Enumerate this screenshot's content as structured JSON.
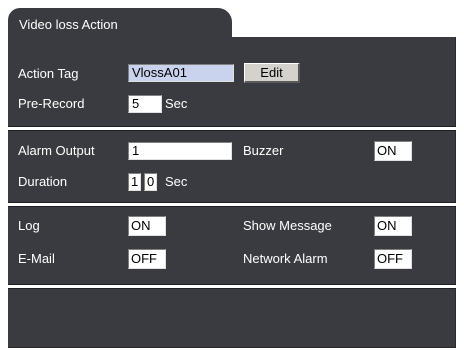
{
  "window": {
    "tab_title": "Video loss Action"
  },
  "action": {
    "tag_label": "Action Tag",
    "tag_value": "VlossA01",
    "edit_label": "Edit",
    "prerecord_label": "Pre-Record",
    "prerecord_value": "5",
    "prerecord_unit": "Sec"
  },
  "alarm": {
    "output_label": "Alarm Output",
    "output_value": "1",
    "buzzer_label": "Buzzer",
    "buzzer_value": "ON",
    "duration_label": "Duration",
    "duration_digit1": "1",
    "duration_digit2": "0",
    "duration_unit": "Sec"
  },
  "notify": {
    "log_label": "Log",
    "log_value": "ON",
    "show_message_label": "Show Message",
    "show_message_value": "ON",
    "email_label": "E-Mail",
    "email_value": "OFF",
    "network_alarm_label": "Network Alarm",
    "network_alarm_value": "OFF"
  },
  "colors": {
    "panel": "#3a3b40",
    "divider": "#ffffff",
    "selected_field": "#c9d3ee",
    "button_face": "#d4d2cc"
  }
}
